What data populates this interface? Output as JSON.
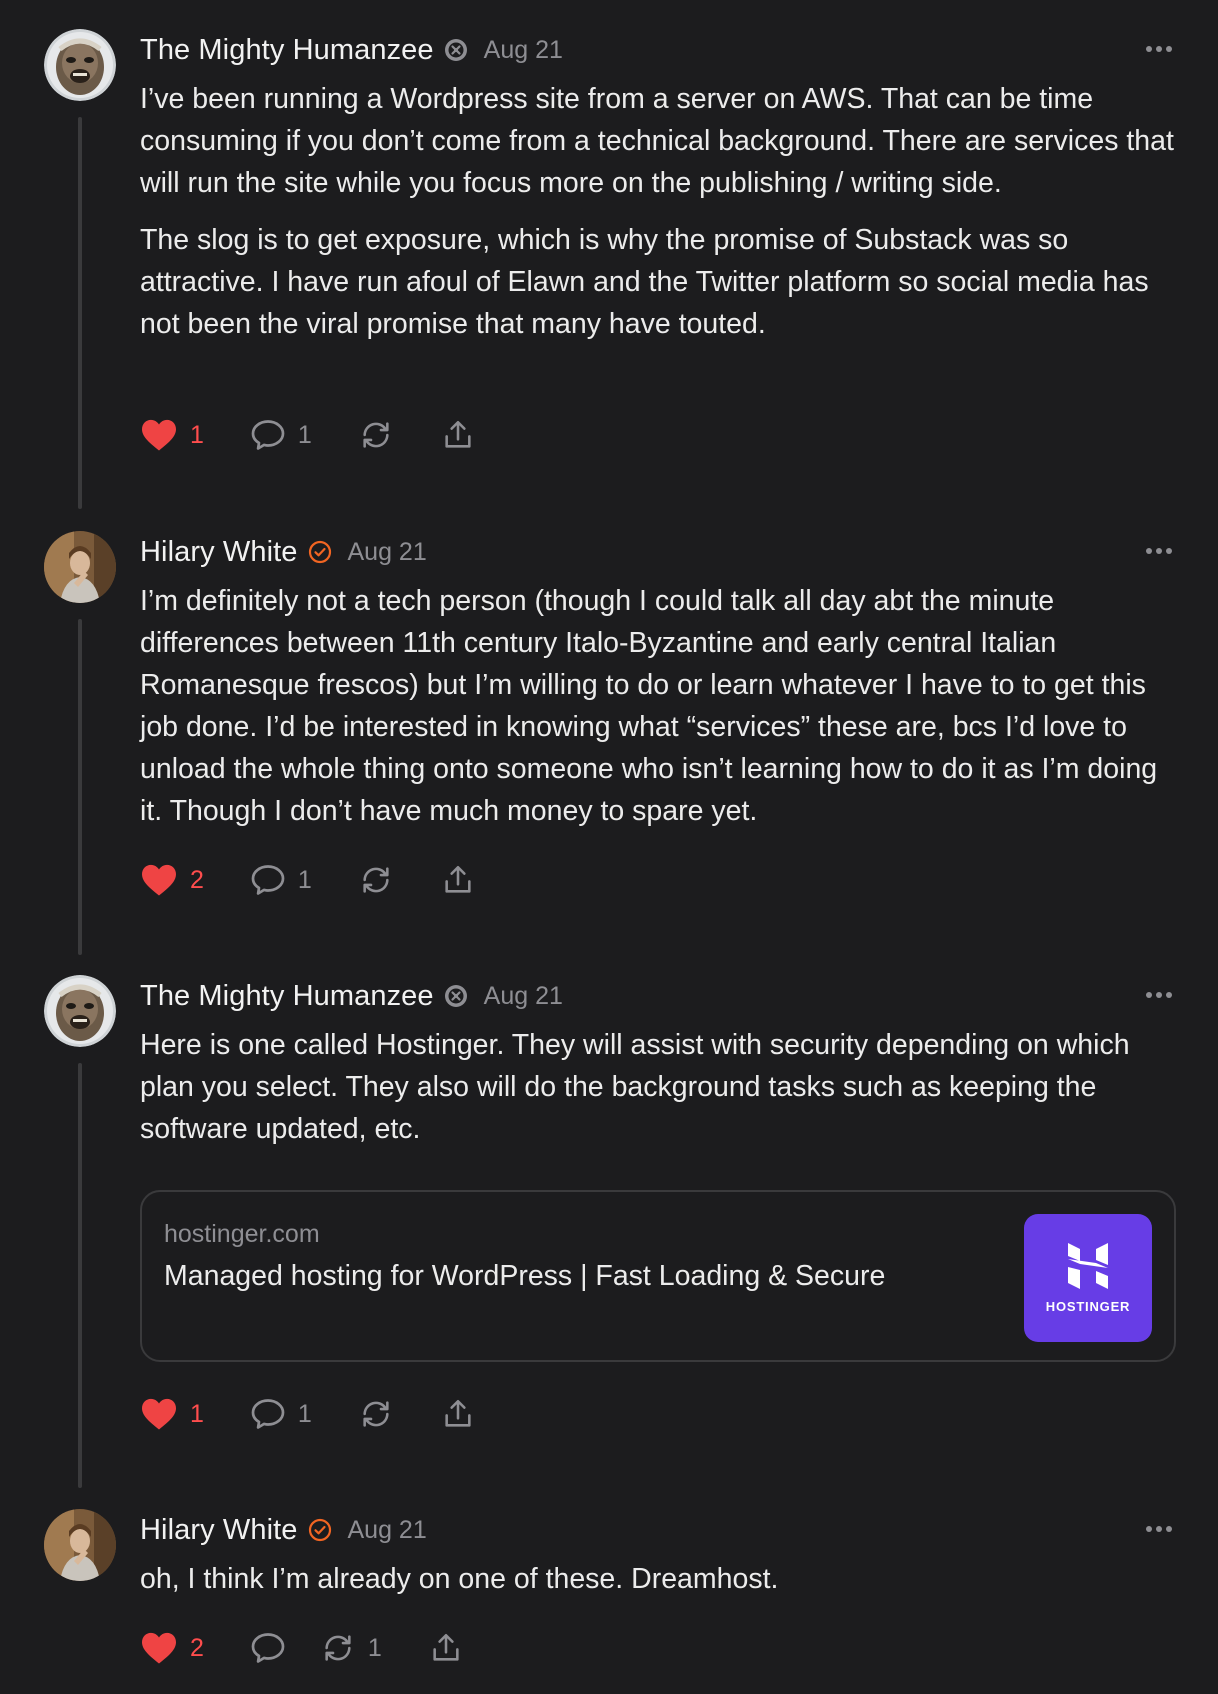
{
  "colors": {
    "background": "#1c1c1e",
    "text": "#ececec",
    "muted": "#8e8e93",
    "like": "#ff4d4d",
    "verified_badge": "#f26522",
    "hostinger_brand": "#673de6"
  },
  "comments": [
    {
      "author": "The Mighty Humanzee",
      "badge_icon": "subscriber-badge-icon",
      "date": "Aug 21",
      "paragraphs": [
        "I’ve been running a Wordpress site from a server on AWS. That can be time consuming if you don’t come from a technical background. There are services that will run the site while you focus more on the publishing / writing side.",
        "The slog is to get exposure, which is why the promise of Substack was so attractive. I have run afoul of Elawn and the Twitter platform so social media has not been the viral promise that many have touted."
      ],
      "likes": "1",
      "replies": "1",
      "restacks": ""
    },
    {
      "author": "Hilary White",
      "badge_icon": "verified-check-icon",
      "date": "Aug 21",
      "paragraphs": [
        "I’m definitely not a tech person (though I could talk all day abt the minute differences between 11th century Italo-Byzantine and early central Italian Romanesque frescos) but I’m willing to do or learn whatever I have to to get this job done. I’d be interested in knowing what “services” these are, bcs I’d love to unload the whole thing onto someone who isn’t learning how to do it as I’m doing it. Though I don’t have much money to spare yet."
      ],
      "likes": "2",
      "replies": "1",
      "restacks": ""
    },
    {
      "author": "The Mighty Humanzee",
      "badge_icon": "subscriber-badge-icon",
      "date": "Aug 21",
      "paragraphs": [
        "Here is one called Hostinger. They will assist with security depending on which plan you select. They also will do the background tasks such as keeping the software updated, etc."
      ],
      "link_card": {
        "domain": "hostinger.com",
        "title": "Managed hosting for WordPress | Fast Loading & Secure",
        "thumb_text": "HOSTINGER"
      },
      "likes": "1",
      "replies": "1",
      "restacks": ""
    },
    {
      "author": "Hilary White",
      "badge_icon": "verified-check-icon",
      "date": "Aug 21",
      "paragraphs": [
        "oh, I think I’m already on one of these. Dreamhost."
      ],
      "likes": "2",
      "replies": "",
      "restacks": "1"
    }
  ]
}
